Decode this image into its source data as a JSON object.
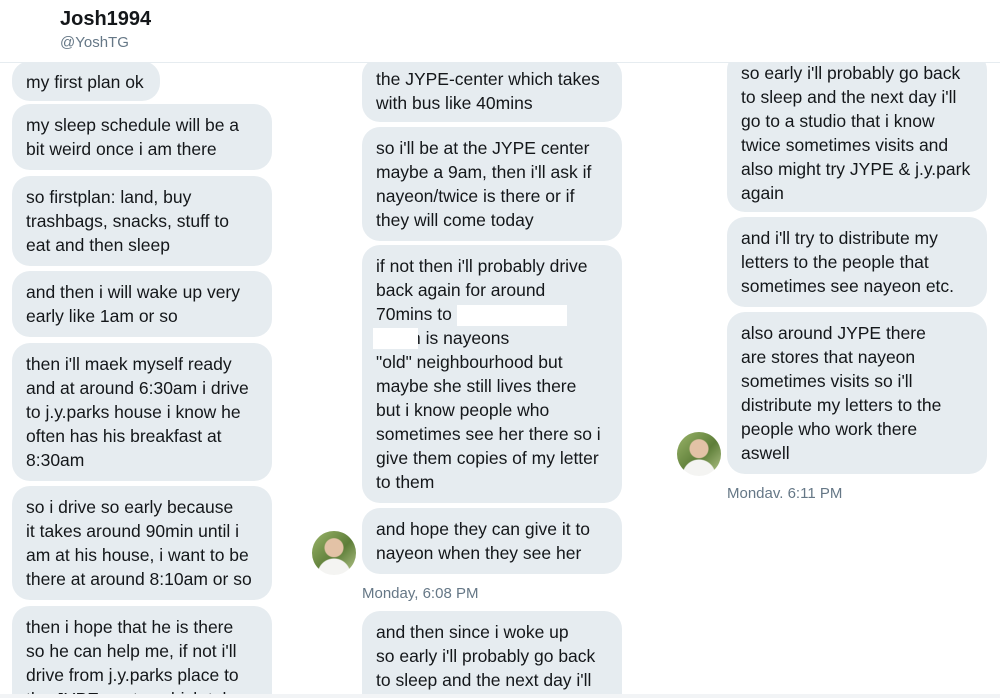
{
  "profile": {
    "name": "Josh1994",
    "handle": "@YoshTG"
  },
  "column1": [
    "my first plan ok",
    "my sleep schedule will be a\nbit weird once i am there",
    "so firstplan: land, buy\ntrashbags, snacks, stuff to\neat and then sleep",
    "and then i will wake up very\nearly like 1am or so",
    "then i'll maek myself ready\nand at around 6:30am i drive\nto j.y.parks house i know he\noften has his breakfast at\n8:30am",
    "so i drive so early because\nit takes around 90min until i\nam at his house, i want to be\nthere at around 8:10am or so",
    "then i hope that he is there\nso he can help me, if not i'll\ndrive from j.y.parks place to\nthe JYPE-center which takes"
  ],
  "column2": [
    "the JYPE-center which takes\nwith bus like 40mins",
    "so i'll be at the JYPE center\nmaybe a 9am, then i'll ask if\nnayeon/twice is there or if\nthey will come today",
    "if not then i'll probably drive\nback again for around\n70mins to\n              which is nayeons\n\"old\" neighbourhood but\nmaybe she still lives there\nbut i know people who\nsometimes see her there so i\ngive them copies of my letter\nto them",
    "and hope they can give it to\nnayeon when they see her",
    "and  then since i woke up\nso early i'll probably go back\nto sleep and the next day i'll"
  ],
  "timestamp2": "Monday, 6:08 PM",
  "column3": [
    "so early i'll probably go back\nto sleep and the next day i'll\ngo to a studio that i know\ntwice sometimes visits and\nalso might try JYPE & j.y.park\nagain",
    "and i'll try to distribute my\nletters to the people that\nsometimes see nayeon etc.",
    "also around JYPE there\nare stores that nayeon\nsometimes visits so i'll\ndistribute my letters to the\npeople who work there\naswell"
  ],
  "timestamp3": "Mondav. 6:11 PM"
}
